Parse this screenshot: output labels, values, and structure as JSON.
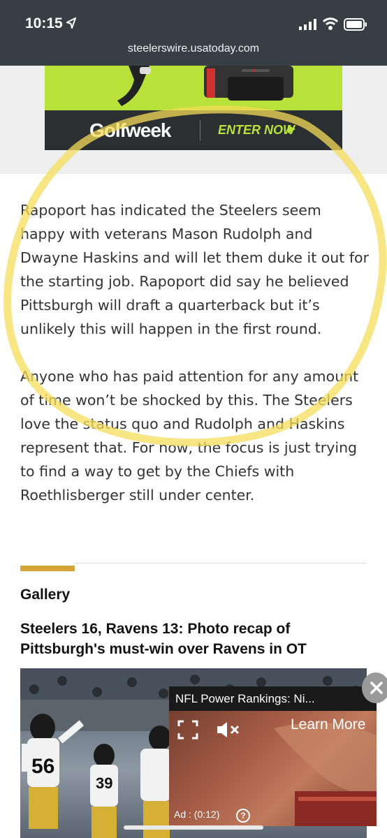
{
  "status_bar": {
    "time": "10:15",
    "location_icon": "location-arrow-icon",
    "signal_icon": "cellular-signal-icon",
    "wifi_icon": "wifi-icon",
    "battery_icon": "battery-icon"
  },
  "browser": {
    "url": "steelerswire.usatoday.com"
  },
  "ad_banner": {
    "brand": "Golfweek",
    "cta": "ENTER NOW",
    "cta_icon": "play-arrow-icon",
    "colors": {
      "green": "#b8e23a",
      "dark": "#2b2f31"
    }
  },
  "article": {
    "paragraphs": [
      "Rapoport has indicated the Steelers seem happy with veterans Mason Rudolph and Dwayne Haskins and will let them duke it out for the starting job. Rapoport did say he believed Pittsburgh will draft a quarterback but it’s unlikely this will happen in the first round.",
      "Anyone who has paid attention for any amount of time won’t be shocked by this. The Steelers love the status quo and Rudolph and Haskins represent that. For now, the focus is just trying to find a way to get by the Chiefs with Roethlisberger still under center."
    ]
  },
  "gallery": {
    "label": "Gallery",
    "title": "Steelers 16, Ravens 13: Photo recap of Pittsburgh's must-win over Ravens in OT",
    "jersey_numbers": [
      "56",
      "39"
    ],
    "accent": "#d6a538"
  },
  "video_ad": {
    "title": "NFL Power Rankings: Ni...",
    "learn_more": "Learn More",
    "timer": "Ad : (0:12)",
    "help": "?",
    "fullscreen_icon": "fullscreen-icon",
    "mute_icon": "mute-icon",
    "close_icon": "close-icon"
  },
  "annotation": {
    "color": "#f5dc5a"
  }
}
